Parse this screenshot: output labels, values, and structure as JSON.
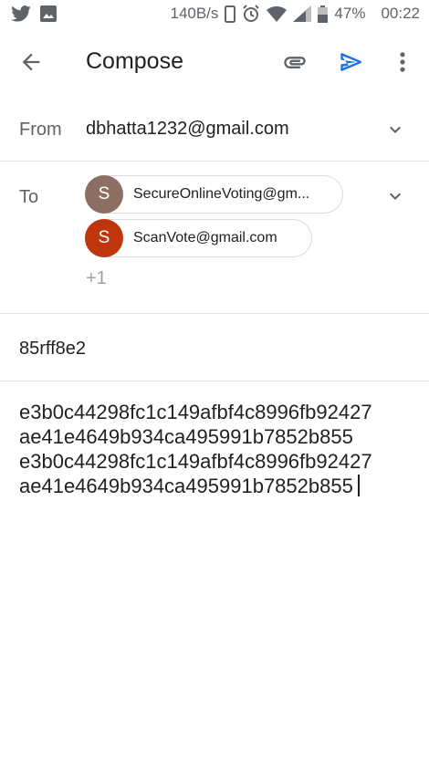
{
  "status_bar": {
    "speed": "140B/s",
    "battery_percent": "47%",
    "time": "00:22",
    "left_icons": [
      "twitter-icon",
      "image-icon"
    ],
    "right_icons": [
      "phone-icon",
      "alarm-icon",
      "wifi-icon",
      "signal-icon",
      "battery-icon"
    ]
  },
  "app_bar": {
    "title": "Compose",
    "icons": [
      "back-arrow-icon",
      "attachment-icon",
      "send-icon",
      "more-vert-icon"
    ],
    "accent_color": "#1a73e8"
  },
  "from": {
    "label": "From",
    "value": "dbhatta1232@gmail.com"
  },
  "to": {
    "label": "To",
    "recipients": [
      {
        "initial": "S",
        "email": "SecureOnlineVoting@gm...",
        "avatar_color": "#8d6e63"
      },
      {
        "initial": "S",
        "email": "ScanVote@gmail.com",
        "avatar_color": "#bf360c"
      }
    ],
    "more_count": "+1"
  },
  "subject": "85rff8e2",
  "body": {
    "lines": [
      "e3b0c44298fc1c149afbf4c8996fb92427",
      "ae41e4649b934ca495991b7852b855",
      "e3b0c44298fc1c149afbf4c8996fb92427",
      "ae41e4649b934ca495991b7852b855"
    ]
  }
}
